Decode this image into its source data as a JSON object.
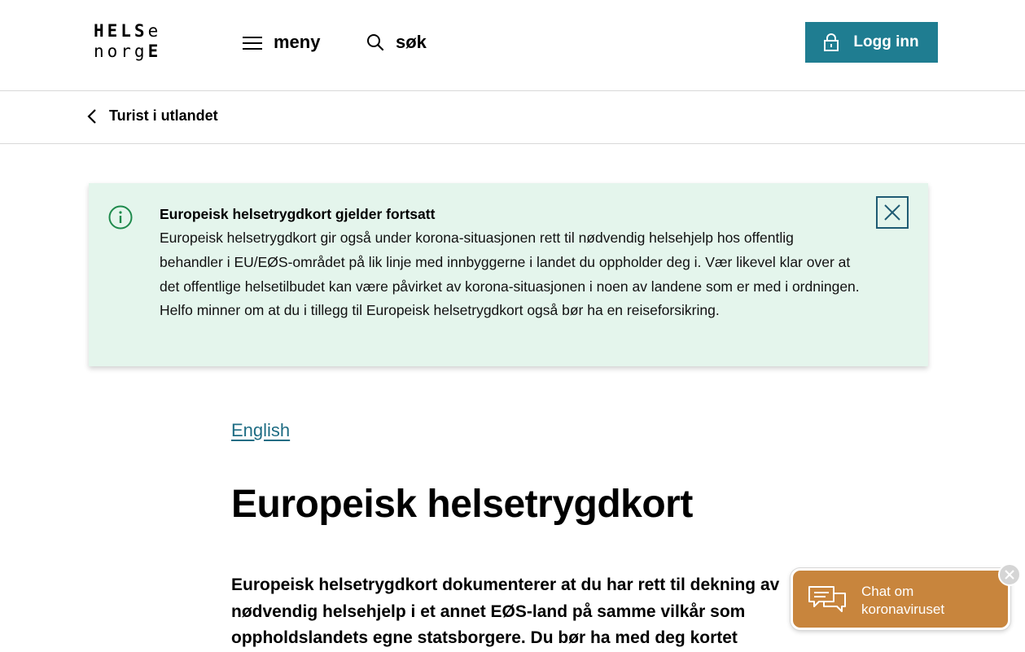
{
  "header": {
    "logo": {
      "row1_upper": "HELS",
      "row1_lower": "e",
      "row2_lower": "norg",
      "row2_upper": "E"
    },
    "menu_label": "meny",
    "search_label": "søk",
    "login_label": "Logg inn",
    "accent_color": "#1f7d91"
  },
  "breadcrumb": {
    "back_label": "Turist i utlandet"
  },
  "alert": {
    "title": "Europeisk helsetrygdkort gjelder fortsatt",
    "body": "Europeisk helsetrygdkort gir også under korona-situasjonen rett til nødvendig helsehjelp hos offentlig behandler i EU/EØS-området på lik linje med innbyggerne i landet du oppholder deg i. Vær likevel klar over at det offentlige helsetilbudet kan være påvirket av korona-situasjonen i noen av landene som er med i ordningen. Helfo minner om at du i tillegg til Europeisk helsetrygdkort også bør ha en reiseforsikring.",
    "background_color": "#e4f5ec",
    "icon": "info-icon"
  },
  "main": {
    "language_link": "English",
    "title": "Europeisk helsetrygdkort",
    "lead": "Europeisk helsetrygdkort dokumenterer at du har rett til dekning av nødvendig helsehjelp i et annet EØS-land på samme vilkår som oppholdslandets egne statsborgere. Du bør ha med deg kortet"
  },
  "chat": {
    "label_line1": "Chat om",
    "label_line2": "koronaviruset",
    "background_color": "#c8853d",
    "icon": "chat-bubbles-icon"
  }
}
